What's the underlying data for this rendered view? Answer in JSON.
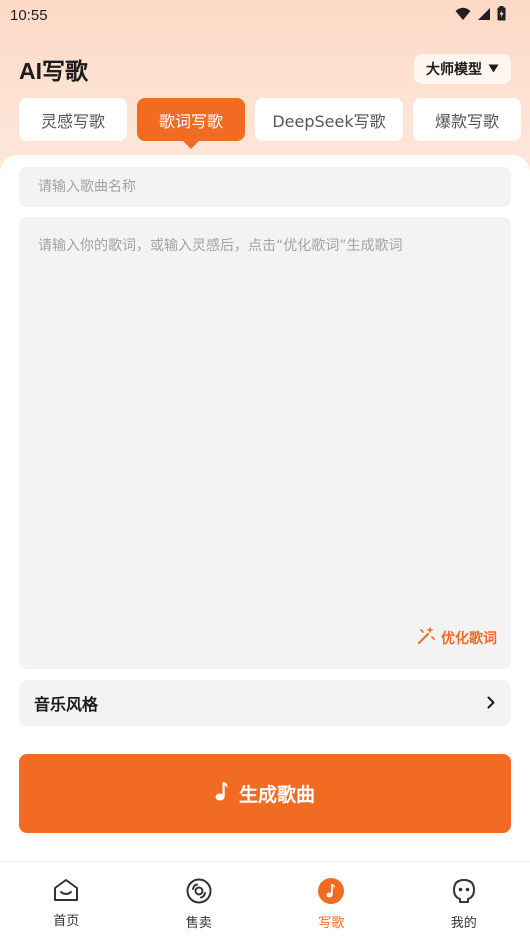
{
  "status_bar": {
    "time": "10:55"
  },
  "header": {
    "title": "AI写歌",
    "model_label": "大师模型"
  },
  "tabs": [
    {
      "label": "灵感写歌"
    },
    {
      "label": "歌词写歌"
    },
    {
      "label": "DeepSeek写歌"
    },
    {
      "label": "爆款写歌"
    }
  ],
  "active_tab": "歌词写歌",
  "form": {
    "song_name_placeholder": "请输入歌曲名称",
    "lyrics_placeholder": "请输入你的歌词，或输入灵感后，点击“优化歌词”生成歌词",
    "optimize_label": "优化歌词",
    "style_label": "音乐风格",
    "generate_label": "生成歌曲"
  },
  "bottom_nav": [
    {
      "label": "首页",
      "icon": "home-icon"
    },
    {
      "label": "售卖",
      "icon": "disc-icon"
    },
    {
      "label": "写歌",
      "icon": "music-note-icon"
    },
    {
      "label": "我的",
      "icon": "profile-icon"
    }
  ],
  "active_nav": "写歌",
  "colors": {
    "accent": "#f26b23",
    "header_bg": "#fdd9c6",
    "field_bg": "#f3f3f3"
  }
}
